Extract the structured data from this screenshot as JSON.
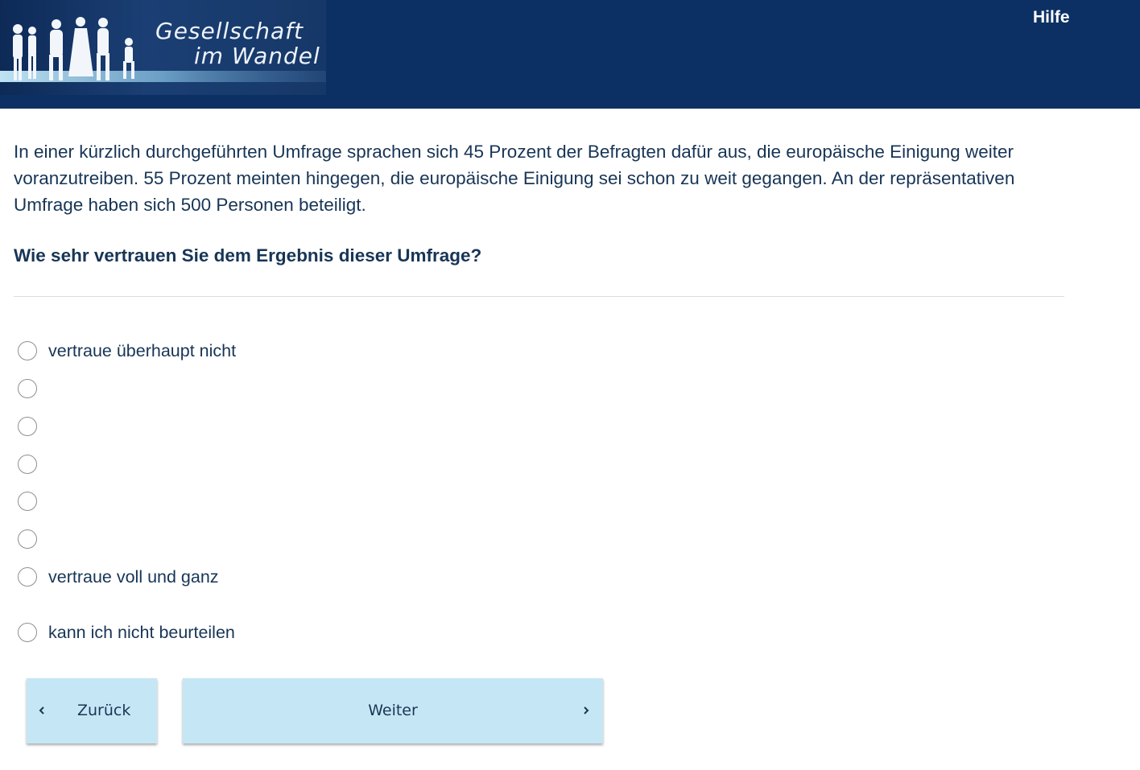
{
  "header": {
    "logo_line1": "Gesellschaft",
    "logo_line2": "im Wandel",
    "help_label": "Hilfe"
  },
  "survey": {
    "intro_text": "In einer kürzlich durchgeführten Umfrage sprachen sich 45 Prozent der Befragten dafür aus, die europäische Einigung weiter voranzutreiben. 55 Prozent meinten hingegen, die europäische Einigung sei schon zu weit gegangen. An der repräsentativen Umfrage haben sich 500 Personen beteiligt.",
    "question": "Wie sehr vertrauen Sie dem Ergebnis dieser Umfrage?",
    "options": [
      {
        "label": "vertraue überhaupt nicht",
        "selected": false
      },
      {
        "label": "",
        "selected": false
      },
      {
        "label": "",
        "selected": false
      },
      {
        "label": "",
        "selected": false
      },
      {
        "label": "",
        "selected": false
      },
      {
        "label": "",
        "selected": false
      },
      {
        "label": "vertraue voll und ganz",
        "selected": false
      },
      {
        "label": "kann ich nicht beurteilen",
        "selected": false
      }
    ]
  },
  "navigation": {
    "back_label": "Zurück",
    "next_label": "Weiter"
  },
  "colors": {
    "header_bg": "#0c3063",
    "button_bg": "#c5e7f5",
    "text": "#173556"
  }
}
